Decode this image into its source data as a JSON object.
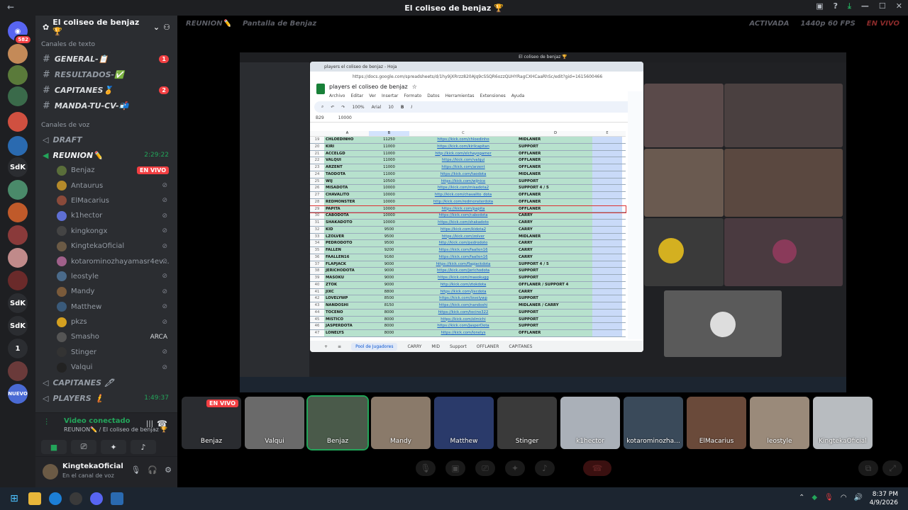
{
  "window": {
    "title": "El coliseo de benjaz 🏆"
  },
  "server": {
    "name": "El coliseo de benjaz 🏆"
  },
  "text_category": "Canales de texto",
  "text_channels": [
    {
      "name": "GENERAL-📋",
      "badge": "1"
    },
    {
      "name": "RESULTADOS-✅",
      "badge": ""
    },
    {
      "name": "CAPITANES🏅",
      "badge": "2"
    },
    {
      "name": "MANDA-TU-CV-📬",
      "badge": ""
    }
  ],
  "voice_category": "Canales de voz",
  "voice_channels": {
    "draft": "DRAFT",
    "reunion": "REUNION✏️",
    "reunion_time": "2:29:22",
    "capitanes": "CAPITANES 🖊",
    "players": "PLAYERS 🧜",
    "players_time": "1:49:37"
  },
  "members": [
    {
      "name": "Benjaz",
      "live": "EN VIVO",
      "color": "#5a6e3a"
    },
    {
      "name": "Antaurus",
      "live": "",
      "color": "#b58a2a"
    },
    {
      "name": "ElMacarius",
      "live": "",
      "color": "#8a4a3a"
    },
    {
      "name": "k1hector",
      "live": "",
      "color": "#5e6fd4"
    },
    {
      "name": "kingkongx",
      "live": "",
      "color": "#444"
    },
    {
      "name": "KingtekaOficial",
      "live": "",
      "color": "#6b5a45"
    },
    {
      "name": "kotarominozhayamasr4ev...",
      "live": "",
      "color": "#a0608a"
    },
    {
      "name": "leostyle",
      "live": "",
      "color": "#4a6a8a"
    },
    {
      "name": "Mandy",
      "live": "",
      "color": "#7a5a3a"
    },
    {
      "name": "Matthew",
      "live": "",
      "color": "#3a5a7a"
    },
    {
      "name": "pkzs",
      "live": "",
      "color": "#d4a020"
    },
    {
      "name": "Smasho",
      "live": "ARCA",
      "color": "#555"
    },
    {
      "name": "Stinger",
      "live": "",
      "color": "#333"
    },
    {
      "name": "Valqui",
      "live": "",
      "color": "#222"
    }
  ],
  "voice_panel": {
    "title": "Video conectado",
    "subtitle": "REUNION✏️ / El coliseo de benjaz 🏆"
  },
  "user": {
    "name": "KingtekaOficial",
    "status": "En el canal de voz"
  },
  "guild_badges": {
    "top": "582",
    "new": "NUEVO"
  },
  "stage": {
    "channel": "REUNION✏️",
    "share_title": "Pantalla de Benjaz",
    "status": "ACTIVADA",
    "quality": "1440p 60 FPS",
    "live": "EN VIVO"
  },
  "sheet": {
    "tab": "players el coliseo de benjaz - Hoja",
    "url": "https://docs.google.com/spreadsheets/d/1hy9jXRrzz820AJq9cSSQR6ozzQUHYRagCXHCaaRhSc/edit?gid=1615600466",
    "doc_title": "players el coliseo de benjaz",
    "menu": [
      "Archivo",
      "Editar",
      "Ver",
      "Insertar",
      "Formato",
      "Datos",
      "Herramientas",
      "Extensiones",
      "Ayuda"
    ],
    "zoom": "100%",
    "font": "Arial",
    "font_size": "10",
    "cell_ref": "B29",
    "formula": "10000",
    "columns": [
      "A",
      "B",
      "C",
      "D",
      "E"
    ],
    "rows": [
      [
        "19",
        "CHLOEDINHO",
        "11250",
        "https://kick.com/chloedinho",
        "MIDLANER"
      ],
      [
        "20",
        "KIRI",
        "11000",
        "https://kick.com/kirilcapitan",
        "SUPPORT"
      ],
      [
        "21",
        "ACCELGD",
        "11000",
        "http://kick.com/elchayogamer",
        "OFFLANER"
      ],
      [
        "22",
        "VALQUI",
        "11000",
        "https://kick.com/valqui",
        "OFFLANER"
      ],
      [
        "23",
        "ARZENT",
        "11000",
        "https://kick.com/arzent",
        "OFFLANER"
      ],
      [
        "24",
        "TAODOTA",
        "11000",
        "https://kick.com/taodota",
        "MIDLANER"
      ],
      [
        "25",
        "WIJ",
        "10500",
        "https://kick.com/wijnice",
        "SUPPORT"
      ],
      [
        "26",
        "MISADOTA",
        "10000",
        "https://kick.com/misadota2",
        "SUPPORT 4 / 5"
      ],
      [
        "27",
        "CHAVALITO",
        "10000",
        "http://kick.com/chavalito_dota",
        "OFFLANER"
      ],
      [
        "28",
        "REDMONSTER",
        "10000",
        "http://kick.com/redmonsterdota",
        "OFFLANER"
      ],
      [
        "29",
        "PAPITA",
        "10000",
        "https://kick.com/papita",
        "OFFLANER"
      ],
      [
        "30",
        "CABODOTA",
        "10000",
        "https://kick.com/cabodota",
        "CARRY"
      ],
      [
        "31",
        "SHAKADOTO",
        "10000",
        "https://kick.com/shakadoto",
        "CARRY"
      ],
      [
        "32",
        "KID",
        "9500",
        "https://kick.com/kidota2",
        "CARRY"
      ],
      [
        "33",
        "LZOLVER",
        "9500",
        "https://kick.com/zolver",
        "MIDLANER"
      ],
      [
        "34",
        "PEDRODOTO",
        "9500",
        "http://kick.com/pedrodoto",
        "CARRY"
      ],
      [
        "35",
        "FALLEN",
        "9200",
        "https://kick.com/faallen16",
        "CARRY"
      ],
      [
        "36",
        "FAALLEN16",
        "9160",
        "https://kick.com/faallen16",
        "CARRY"
      ],
      [
        "37",
        "FLAPJACK",
        "9000",
        "https://kick.com/flapjackdota",
        "SUPPORT 4 / 5"
      ],
      [
        "38",
        "JERICHODOTA",
        "9000",
        "https://kick.com/jerichodota",
        "SUPPORT"
      ],
      [
        "39",
        "MASOKU",
        "9000",
        "https://kick.com/masokugg",
        "SUPPORT"
      ],
      [
        "40",
        "ZTOK",
        "9000",
        "http://kick.com/ztokdota",
        "OFFLANER / SUPPORT 4"
      ],
      [
        "41",
        "JIXC",
        "8800",
        "https://kick.com/jixcdota",
        "CARRY"
      ],
      [
        "42",
        "LOVELYWP",
        "8500",
        "https://kick.com/lovelywp",
        "SUPPORT"
      ],
      [
        "43",
        "NANDOSHI",
        "8150",
        "https://kick.com/nandoshi",
        "MIDLANER / CARRY"
      ],
      [
        "44",
        "TOCENO",
        "8000",
        "https://kick.com/tocino322",
        "SUPPORT"
      ],
      [
        "45",
        "MISTICO",
        "8000",
        "https://kick.com/elmichi",
        "SUPPORT"
      ],
      [
        "46",
        "JASPERDOTA",
        "8000",
        "https://kick.com/JasperDota",
        "SUPPORT"
      ],
      [
        "47",
        "LONELYS",
        "8000",
        "https://kick.com/lonelys",
        "OFFLANER"
      ]
    ],
    "sheet_tabs": [
      "Pool de Jugadores",
      "CARRY",
      "MID",
      "Support",
      "OFFLANER",
      "CAPITANES"
    ]
  },
  "strip": [
    {
      "name": "Benjaz",
      "color": "#2a2c30"
    },
    {
      "name": "Valqui",
      "color": "#6a6a6a"
    },
    {
      "name": "Benjaz",
      "color": "#4a5a4a"
    },
    {
      "name": "Mandy",
      "color": "#8a7a6a"
    },
    {
      "name": "Matthew",
      "color": "#2a3a6a"
    },
    {
      "name": "Stinger",
      "color": "#3a3a3a"
    },
    {
      "name": "k1hector",
      "color": "#aab0b8"
    },
    {
      "name": "kotarominozha...",
      "color": "#3a4a5a"
    },
    {
      "name": "ElMacarius",
      "color": "#6a4a3a"
    },
    {
      "name": "leostyle",
      "color": "#9a8a7a"
    },
    {
      "name": "KingtekaOficial",
      "color": "#b8bcc0"
    }
  ],
  "taskbar": {
    "time": "8:37 PM",
    "date": "4/9/2026"
  }
}
